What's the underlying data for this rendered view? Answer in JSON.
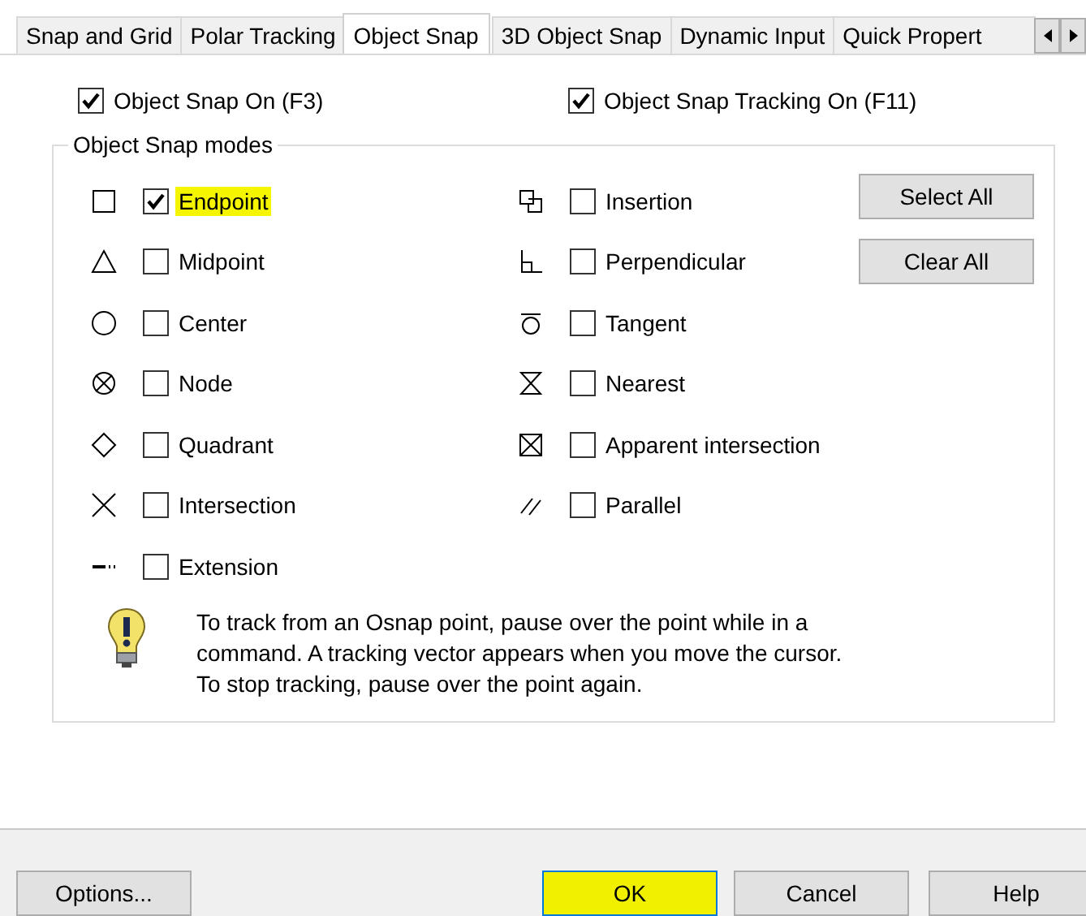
{
  "tabs": [
    {
      "label": "Snap and Grid",
      "selected": false
    },
    {
      "label": "Polar Tracking",
      "selected": false
    },
    {
      "label": "Object Snap",
      "selected": true
    },
    {
      "label": "3D Object Snap",
      "selected": false
    },
    {
      "label": "Dynamic Input",
      "selected": false
    },
    {
      "label": "Quick Propert",
      "selected": false
    }
  ],
  "options": [
    {
      "label": "Object Snap On (F3)",
      "checked": true
    },
    {
      "label": "Object Snap Tracking On (F11)",
      "checked": true
    }
  ],
  "modes_group": {
    "title": "Object Snap modes",
    "modes": [
      {
        "kind": "endpoint",
        "label": "Endpoint",
        "checked": true,
        "highlighted": true
      },
      {
        "kind": "midpoint",
        "label": "Midpoint",
        "checked": false,
        "highlighted": false
      },
      {
        "kind": "center",
        "label": "Center",
        "checked": false,
        "highlighted": false
      },
      {
        "kind": "node",
        "label": "Node",
        "checked": false,
        "highlighted": false
      },
      {
        "kind": "quadrant",
        "label": "Quadrant",
        "checked": false,
        "highlighted": false
      },
      {
        "kind": "intersection",
        "label": "Intersection",
        "checked": false,
        "highlighted": false
      },
      {
        "kind": "extension",
        "label": "Extension",
        "checked": false,
        "highlighted": false
      },
      {
        "kind": "insertion",
        "label": "Insertion",
        "checked": false,
        "highlighted": false
      },
      {
        "kind": "perpendicular",
        "label": "Perpendicular",
        "checked": false,
        "highlighted": false
      },
      {
        "kind": "tangent",
        "label": "Tangent",
        "checked": false,
        "highlighted": false
      },
      {
        "kind": "nearest",
        "label": "Nearest",
        "checked": false,
        "highlighted": false
      },
      {
        "kind": "apparent",
        "label": "Apparent intersection",
        "checked": false,
        "highlighted": false
      },
      {
        "kind": "parallel",
        "label": "Parallel",
        "checked": false,
        "highlighted": false
      }
    ],
    "buttons": [
      "Select All",
      "Clear All"
    ],
    "hint": "To track from an Osnap point, pause over the point while in a command.  A tracking vector appears when you move the cursor.  To stop tracking, pause over the point again."
  },
  "footer_buttons": [
    {
      "label": "Options...",
      "highlighted": false
    },
    {
      "label": "OK",
      "highlighted": true
    },
    {
      "label": "Cancel",
      "highlighted": false
    },
    {
      "label": "Help",
      "highlighted": false
    }
  ]
}
